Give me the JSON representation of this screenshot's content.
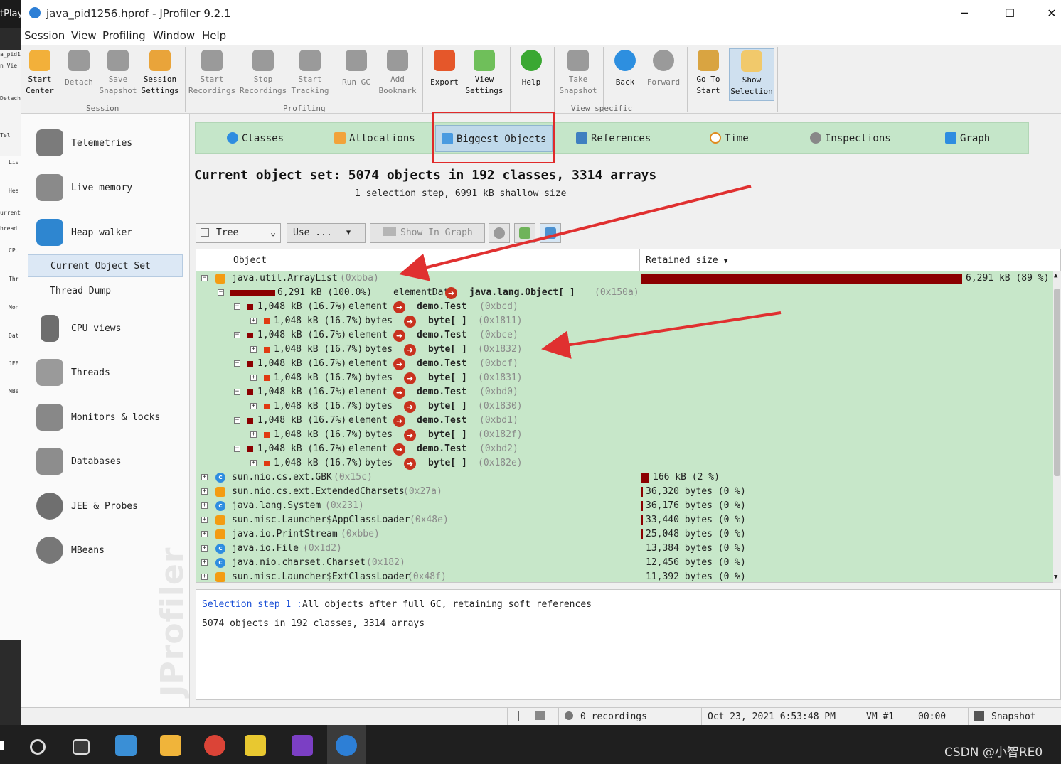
{
  "left_strip": {
    "label_1": "tPlay",
    "label_2": "a_pid1",
    "label_3": "n Vie",
    "label_4": "Detach",
    "label_5": "Tel",
    "label_6": "Liv",
    "label_7": "Hea",
    "label_8": "urrent",
    "label_9": "hread",
    "label_10": "CPU",
    "label_11": "Thr",
    "label_12": "Mon",
    "label_13": "Dat",
    "label_14": "JEE",
    "label_15": "MBe"
  },
  "window": {
    "title": "java_pid1256.hprof - JProfiler 9.2.1",
    "minimize": "─",
    "maximize": "☐",
    "close": "✕"
  },
  "menu": [
    "Session",
    "View",
    "Profiling",
    "Window",
    "Help"
  ],
  "toolbar": {
    "buttons": [
      {
        "line1": "Start",
        "line2": "Center"
      },
      {
        "line1": "Detach",
        "line2": ""
      },
      {
        "line1": "Save",
        "line2": "Snapshot"
      },
      {
        "line1": "Session",
        "line2": "Settings"
      },
      {
        "line1": "Start",
        "line2": "Recordings"
      },
      {
        "line1": "Stop",
        "line2": "Recordings"
      },
      {
        "line1": "Start",
        "line2": "Tracking"
      },
      {
        "line1": "Run GC",
        "line2": ""
      },
      {
        "line1": "Add",
        "line2": "Bookmark"
      },
      {
        "line1": "Export",
        "line2": ""
      },
      {
        "line1": "View",
        "line2": "Settings"
      },
      {
        "line1": "Help",
        "line2": ""
      },
      {
        "line1": "Take",
        "line2": "Snapshot"
      },
      {
        "line1": "Back",
        "line2": ""
      },
      {
        "line1": "Forward",
        "line2": ""
      },
      {
        "line1": "Go To",
        "line2": "Start"
      },
      {
        "line1": "Show",
        "line2": "Selection"
      }
    ],
    "groups": [
      "Session",
      "Profiling",
      "View specific"
    ]
  },
  "sidebar": {
    "items": [
      "Telemetries",
      "Live memory",
      "Heap walker",
      "CPU views",
      "Threads",
      "Monitors & locks",
      "Databases",
      "JEE & Probes",
      "MBeans"
    ],
    "heap_sub": [
      "Current Object Set",
      "Thread Dump"
    ],
    "watermark": "JProfiler"
  },
  "tabs": [
    "Classes",
    "Allocations",
    "Biggest Objects",
    "References",
    "Time",
    "Inspections",
    "Graph"
  ],
  "summary": {
    "title": "Current object set: 5074 objects in 192 classes, 3314 arrays",
    "sub": "1 selection step, 6991 kB shallow size"
  },
  "controls": {
    "view_mode": "Tree",
    "use": "Use ...",
    "show_in_graph": "Show In Graph"
  },
  "tree": {
    "col_object": "Object",
    "col_retained": "Retained size",
    "root": {
      "name": "java.util.ArrayList",
      "addr": "(0xbba)",
      "retained": "6,291 kB (89 %)",
      "fraction": 0.89
    },
    "elementData": {
      "size": "6,291 kB (100.0%)",
      "field": "elementData",
      "type": "java.lang.Object[ ]",
      "addr": "(0x150a)"
    },
    "children": [
      {
        "el_size": "1,048 kB (16.7%)",
        "el_field": "element",
        "el_type": "demo.Test",
        "el_addr": "(0xbcd)",
        "b_size": "1,048 kB (16.7%)",
        "b_field": "bytes",
        "b_type": "byte[ ]",
        "b_addr": "(0x1811)"
      },
      {
        "el_size": "1,048 kB (16.7%)",
        "el_field": "element",
        "el_type": "demo.Test",
        "el_addr": "(0xbce)",
        "b_size": "1,048 kB (16.7%)",
        "b_field": "bytes",
        "b_type": "byte[ ]",
        "b_addr": "(0x1832)"
      },
      {
        "el_size": "1,048 kB (16.7%)",
        "el_field": "element",
        "el_type": "demo.Test",
        "el_addr": "(0xbcf)",
        "b_size": "1,048 kB (16.7%)",
        "b_field": "bytes",
        "b_type": "byte[ ]",
        "b_addr": "(0x1831)"
      },
      {
        "el_size": "1,048 kB (16.7%)",
        "el_field": "element",
        "el_type": "demo.Test",
        "el_addr": "(0xbd0)",
        "b_size": "1,048 kB (16.7%)",
        "b_field": "bytes",
        "b_type": "byte[ ]",
        "b_addr": "(0x1830)"
      },
      {
        "el_size": "1,048 kB (16.7%)",
        "el_field": "element",
        "el_type": "demo.Test",
        "el_addr": "(0xbd1)",
        "b_size": "1,048 kB (16.7%)",
        "b_field": "bytes",
        "b_type": "byte[ ]",
        "b_addr": "(0x182f)"
      },
      {
        "el_size": "1,048 kB (16.7%)",
        "el_field": "element",
        "el_type": "demo.Test",
        "el_addr": "(0xbd2)",
        "b_size": "1,048 kB (16.7%)",
        "b_field": "bytes",
        "b_type": "byte[ ]",
        "b_addr": "(0x182e)"
      }
    ],
    "others": [
      {
        "name": "sun.nio.cs.ext.GBK",
        "addr": "(0x15c)",
        "retained": "166 kB (2 %)",
        "icon": "class"
      },
      {
        "name": "sun.nio.cs.ext.ExtendedCharsets",
        "addr": "(0x27a)",
        "retained": "36,320 bytes (0 %)",
        "icon": "object"
      },
      {
        "name": "java.lang.System",
        "addr": "(0x231)",
        "retained": "36,176 bytes (0 %)",
        "icon": "class"
      },
      {
        "name": "sun.misc.Launcher$AppClassLoader",
        "addr": "(0x48e)",
        "retained": "33,440 bytes (0 %)",
        "icon": "object"
      },
      {
        "name": "java.io.PrintStream",
        "addr": "(0xbbe)",
        "retained": "25,048 bytes (0 %)",
        "icon": "object"
      },
      {
        "name": "java.io.File",
        "addr": "(0x1d2)",
        "retained": "13,384 bytes (0 %)",
        "icon": "class"
      },
      {
        "name": "java.nio.charset.Charset",
        "addr": "(0x182)",
        "retained": "12,456 bytes (0 %)",
        "icon": "class"
      },
      {
        "name": "sun.misc.Launcher$ExtClassLoader",
        "addr": "(0x48f)",
        "retained": "11,392 bytes (0 %)",
        "icon": "object"
      }
    ]
  },
  "bottom": {
    "step_link": "Selection step 1 :",
    "step_desc": "All objects after full GC, retaining soft references",
    "count": "5074 objects in 192 classes, 3314 arrays"
  },
  "status": {
    "recordings": "0 recordings",
    "datetime": "Oct 23, 2021 6:53:48 PM",
    "vm": "VM #1",
    "time": "00:00",
    "mode": "Snapshot"
  },
  "taskbar": {
    "watermark": "CSDN @小智RE0"
  }
}
